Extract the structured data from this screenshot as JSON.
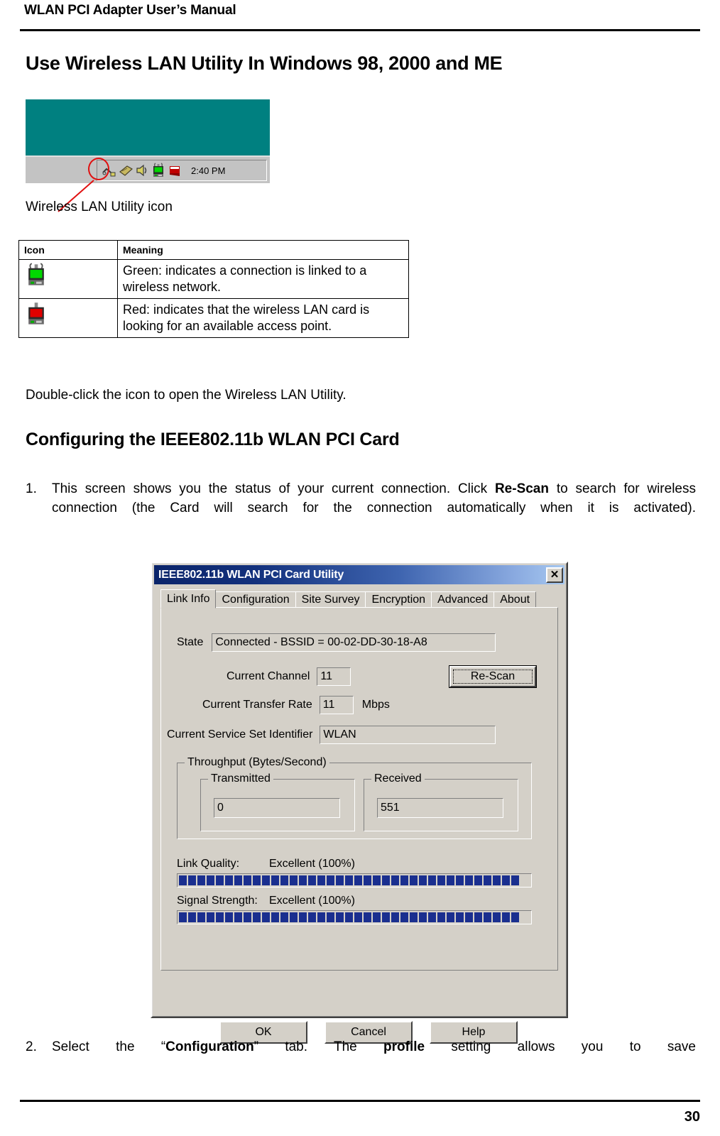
{
  "document": {
    "running_header": "WLAN PCI Adapter User’s Manual",
    "page_number": "30"
  },
  "headings": {
    "h1": "Use Wireless LAN Utility In Windows 98, 2000 and ME",
    "h2": "Configuring the IEEE802.11b WLAN PCI Card"
  },
  "taskbar_figure": {
    "caption": "Wireless LAN Utility icon",
    "clock": "2:40 PM",
    "desktop_color": "#008080",
    "tray_icons": [
      "network-cable-icon",
      "pc-card-icon",
      "speaker-icon",
      "wlan-green-icon",
      "red-flag-icon"
    ],
    "highlight_color": "#e01010"
  },
  "icon_table": {
    "headers": [
      "Icon",
      "Meaning"
    ],
    "rows": [
      {
        "icon": "wlan-green-icon",
        "icon_color": "#00d800",
        "meaning": "Green: indicates a connection is linked to a wireless network."
      },
      {
        "icon": "wlan-red-icon",
        "icon_color": "#e00000",
        "meaning": "Red: indicates that the wireless LAN card is looking for an available access point."
      }
    ]
  },
  "paragraphs": {
    "double_click": "Double-click the icon to open the Wireless LAN Utility.",
    "item1_number": "1.",
    "item1_pre": "This screen shows you the status of your current connection. Click ",
    "item1_bold": "Re-Scan",
    "item1_post": " to search for wireless connection (the Card will search for the connection automatically when it is activated).",
    "item2_number": "2.",
    "item2_a": "Select the “",
    "item2_bold1": "Configuration",
    "item2_b": "” tab. The ",
    "item2_bold2": "profile",
    "item2_c": " setting allows you to save"
  },
  "dialog": {
    "title": "IEEE802.11b WLAN PCI Card Utility",
    "close_label": "✕",
    "tabs": [
      {
        "label": "Link Info",
        "active": true
      },
      {
        "label": "Configuration",
        "active": false
      },
      {
        "label": "Site Survey",
        "active": false
      },
      {
        "label": "Encryption",
        "active": false
      },
      {
        "label": "Advanced",
        "active": false
      },
      {
        "label": "About",
        "active": false
      }
    ],
    "fields": {
      "state_label": "State",
      "state_value": "Connected - BSSID = 00-02-DD-30-18-A8",
      "channel_label": "Current Channel",
      "channel_value": "11",
      "rate_label": "Current Transfer Rate",
      "rate_value": "11",
      "rate_unit": "Mbps",
      "ssid_label": "Current Service Set Identifier",
      "ssid_value": "WLAN"
    },
    "rescan_button": "Re-Scan",
    "throughput": {
      "group_title": "Throughput (Bytes/Second)",
      "transmitted_label": "Transmitted",
      "transmitted_value": "0",
      "received_label": "Received",
      "received_value": "551"
    },
    "meters": {
      "link_quality_label": "Link Quality:",
      "link_quality_value": "Excellent (100%)",
      "link_quality_percent": 100,
      "signal_strength_label": "Signal Strength:",
      "signal_strength_value": "Excellent (100%)",
      "signal_strength_percent": 100,
      "segment_count": 37,
      "segment_color": "#1a2f8f"
    },
    "buttons": [
      {
        "label": "OK"
      },
      {
        "label": "Cancel"
      },
      {
        "label": "Help"
      }
    ]
  }
}
